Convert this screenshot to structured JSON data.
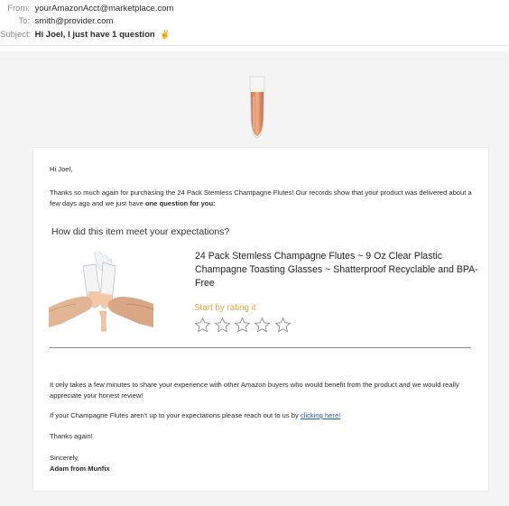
{
  "email_header": {
    "from_label": "From:",
    "from_value": "yourAmazonAcct@marketplace.com",
    "to_label": "To:",
    "to_value": "smith@provider.com",
    "subject_label": "Subject:",
    "subject_value": "Hi Joel, I just have 1 question",
    "subject_icon": "hand-wave-icon"
  },
  "body": {
    "greeting": "Hi Joel,",
    "intro": "Thanks so much again for purchasing the 24 Pack Stemless Champagne Flutes! Our records show that your product was delivered about a few days ago and we just have",
    "intro_bold": "one question for you:",
    "question": "How did this item meet your expectations?",
    "product_title": "24 Pack Stemless Champagne Flutes ~ 9 Oz Clear Plastic Champagne Toasting Glasses ~ Shatterproof Recyclable and BPA-Free",
    "rate_prompt": "Start by rating it",
    "star_count": 5,
    "para2": "It only takes a few minutes to share your experience with other Amazon buyers who would benefit from the product and we would really appreciate your honest review!",
    "para3": "If your Champagne Flutes aren't up to your expectations please reach out to us by",
    "para3_link": "clicking here!",
    "thanks": "Thanks again!",
    "signoff": "Sincerely,",
    "signature": "Adam from Munfix"
  },
  "colors": {
    "rate_prompt": "#f0a040",
    "link": "#1a5cb8",
    "canvas_bg": "#f4f4f4"
  }
}
